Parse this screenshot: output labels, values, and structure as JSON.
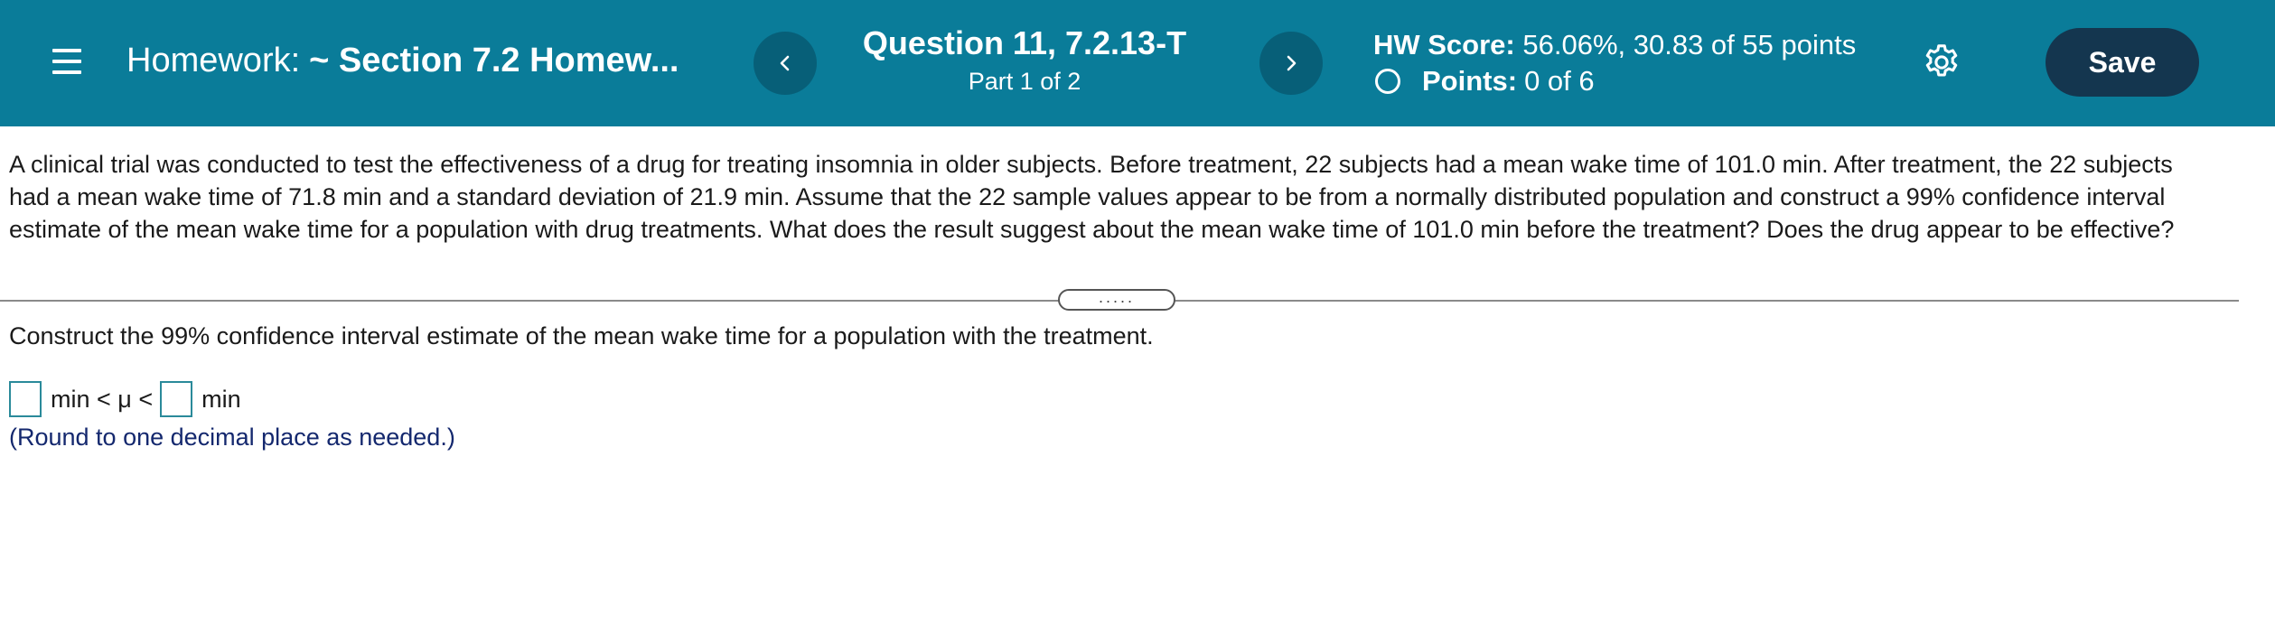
{
  "header": {
    "homework_prefix": "Homework:",
    "homework_name": "~ Section 7.2 Homew...",
    "question_title": "Question 11, 7.2.13-T",
    "question_part": "Part 1 of 2",
    "hw_score_label": "HW Score:",
    "hw_score_value": "56.06%, 30.83 of 55 points",
    "points_label": "Points:",
    "points_value": "0 of 6",
    "save_label": "Save",
    "prev_icon": "chevron-left-icon",
    "next_icon": "chevron-right-icon",
    "settings_icon": "gear-icon",
    "menu_icon": "hamburger-menu-icon"
  },
  "question": {
    "text": "A clinical trial was conducted to test the effectiveness of a drug for treating insomnia in older subjects. Before treatment, 22 subjects had a mean wake time of 101.0 min. After treatment, the 22 subjects had a mean wake time of 71.8 min and a standard deviation of 21.9 min. Assume that the 22 sample values appear to be from a normally distributed population and construct a 99% confidence interval estimate of the mean wake time for a population with drug treatments. What does the result suggest about the mean wake time of 101.0 min before the treatment? Does the drug appear to be effective?",
    "divider_handle": "....."
  },
  "part": {
    "instruction": "Construct the 99% confidence interval estimate of the mean wake time for a population with the treatment.",
    "middle_text": "min < μ <",
    "end_text": "min",
    "lower_value": "",
    "upper_value": "",
    "hint": "(Round to one decimal place as needed.)"
  },
  "colors": {
    "header_bg": "#0a7c99",
    "nav_button_bg": "#075f78",
    "save_button_bg": "#14364f",
    "answer_box_border": "#2a8a9a",
    "hint_text": "#14286e"
  }
}
